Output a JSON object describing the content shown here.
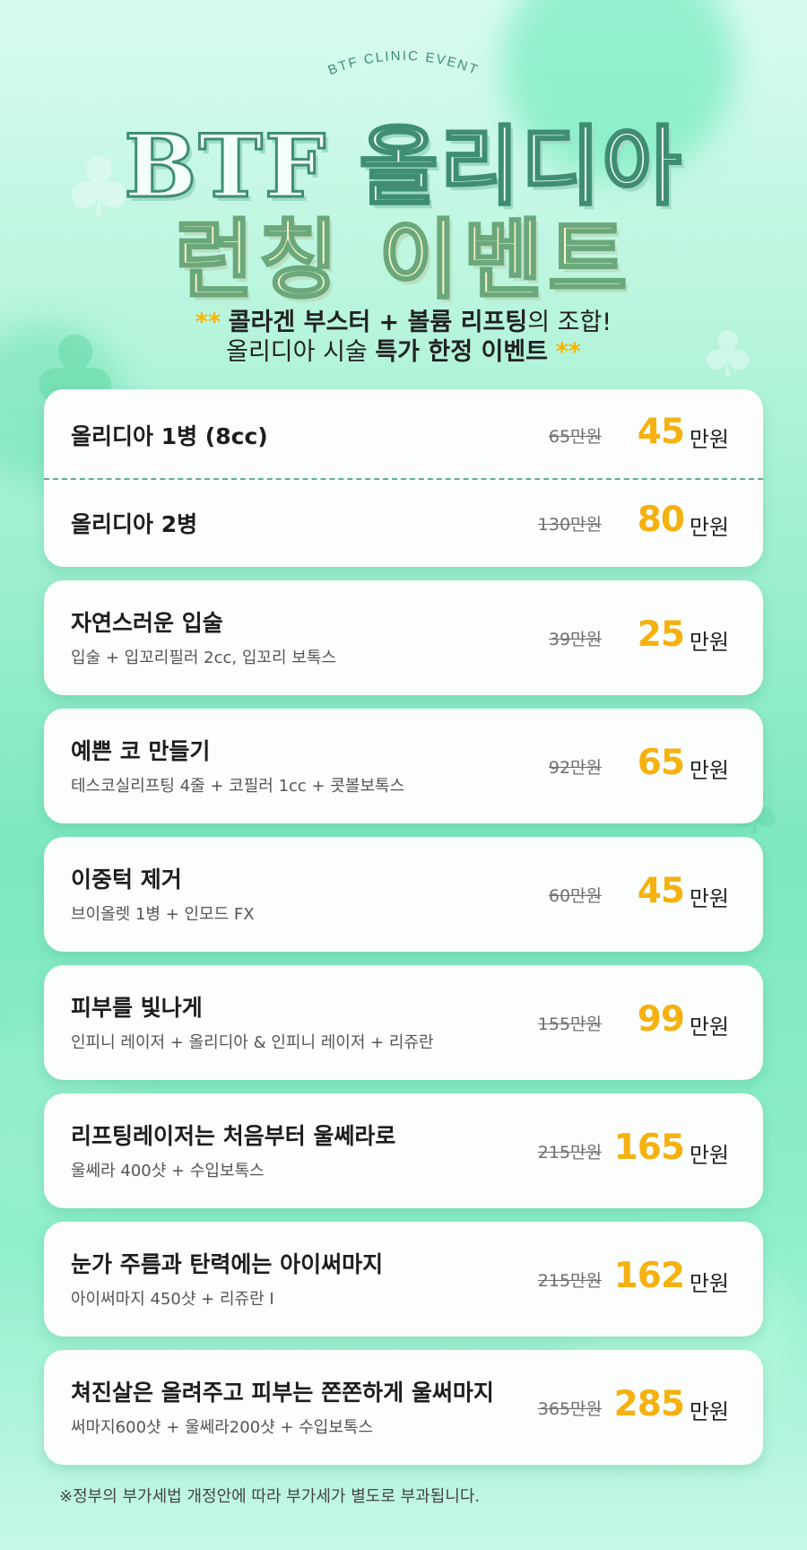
{
  "header": {
    "event_label": "BTF CLINIC EVENT",
    "title_line1": "BTF 올리디아",
    "title_line2": "런칭 이벤트",
    "subtitle": {
      "star": "**",
      "part1_bold": "콜라겐 부스터 + 볼륨 리프팅",
      "part1_rest": "의 조합!",
      "part2_plain": "올리디아 시술 ",
      "part2_bold": "특가 한정 이벤트"
    }
  },
  "items": [
    {
      "name": "올리디아 1병 (8cc)",
      "desc": "",
      "old_price": "65만원",
      "new_price": "45",
      "unit": "만원"
    },
    {
      "name": "올리디아 2병",
      "desc": "",
      "old_price": "130만원",
      "new_price": "80",
      "unit": "만원"
    },
    {
      "name": "자연스러운 입술",
      "desc": "입술 + 입꼬리필러 2cc, 입꼬리 보톡스",
      "old_price": "39만원",
      "new_price": "25",
      "unit": "만원"
    },
    {
      "name": "예쁜 코 만들기",
      "desc": "테스코실리프팅 4줄 + 코필러 1cc + 콧볼보톡스",
      "old_price": "92만원",
      "new_price": "65",
      "unit": "만원"
    },
    {
      "name": "이중턱 제거",
      "desc": "브이올렛 1병 + 인모드 FX",
      "old_price": "60만원",
      "new_price": "45",
      "unit": "만원"
    },
    {
      "name": "피부를 빛나게",
      "desc": "인피니 레이저 + 올리디아 & 인피니 레이저 + 리쥬란",
      "old_price": "155만원",
      "new_price": "99",
      "unit": "만원"
    },
    {
      "name": "리프팅레이저는 처음부터 울쎄라로",
      "desc": "울쎄라 400샷 + 수입보톡스",
      "old_price": "215만원",
      "new_price": "165",
      "unit": "만원"
    },
    {
      "name": "눈가 주름과 탄력에는 아이써마지",
      "desc": "아이써마지 450샷 + 리쥬란 I",
      "old_price": "215만원",
      "new_price": "162",
      "unit": "만원"
    },
    {
      "name": "쳐진살은 올려주고 피부는 쫀쫀하게 울써마지",
      "desc": "써마지600샷 + 울쎄라200샷 + 수입보톡스",
      "old_price": "365만원",
      "new_price": "285",
      "unit": "만원"
    }
  ],
  "footnote": "※정부의 부가세법 개정안에 따라 부가세가 별도로 부과됩니다.",
  "colors": {
    "accent": "#f5b10f",
    "mint": "#7ee8c0",
    "title_stroke": "#3f8e72"
  }
}
